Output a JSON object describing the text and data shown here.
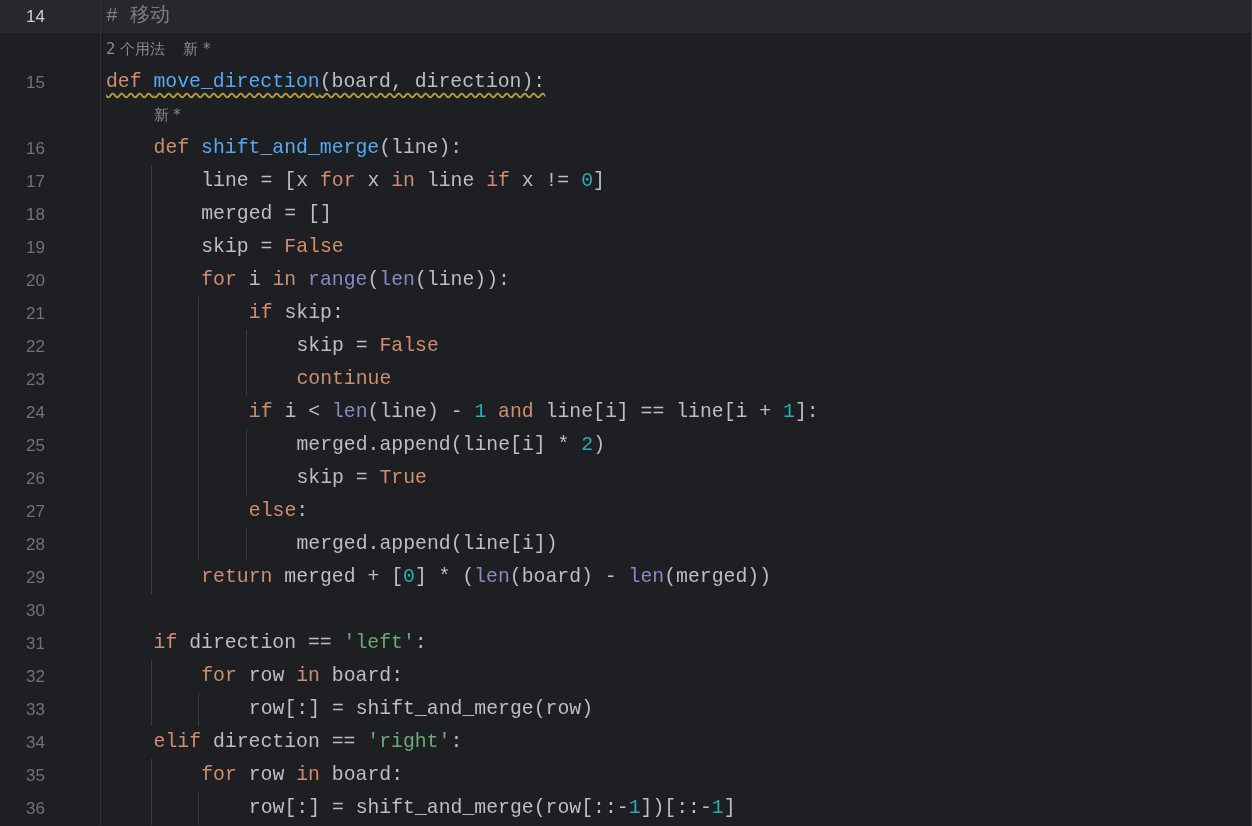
{
  "editor": {
    "lines": [
      {
        "number": "14",
        "current": true,
        "warning": false,
        "tokens": [
          {
            "text": "# 移动",
            "kind": "comment"
          }
        ]
      },
      {
        "number": "15",
        "current": false,
        "warning": true,
        "hints": [
          "2 个用法",
          "新 *"
        ],
        "tokens": [
          {
            "text": "def ",
            "kind": "kw"
          },
          {
            "text": "move_direction",
            "kind": "fn"
          },
          {
            "text": "(board, direction):",
            "kind": "plain"
          }
        ],
        "children": [
          {
            "number": "16",
            "current": false,
            "warning": false,
            "hints": [
              "新 *"
            ],
            "tokens": [
              {
                "text": "def ",
                "kind": "kw"
              },
              {
                "text": "shift_and_merge",
                "kind": "fn"
              },
              {
                "text": "(line):",
                "kind": "plain"
              }
            ],
            "children": [
              {
                "number": "17",
                "current": false,
                "warning": false,
                "tokens": [
                  {
                    "text": "line = [x ",
                    "kind": "plain"
                  },
                  {
                    "text": "for",
                    "kind": "kw"
                  },
                  {
                    "text": " x ",
                    "kind": "plain"
                  },
                  {
                    "text": "in",
                    "kind": "kw"
                  },
                  {
                    "text": " line ",
                    "kind": "plain"
                  },
                  {
                    "text": "if",
                    "kind": "kw"
                  },
                  {
                    "text": " x != ",
                    "kind": "plain"
                  },
                  {
                    "text": "0",
                    "kind": "num"
                  },
                  {
                    "text": "]",
                    "kind": "plain"
                  }
                ]
              },
              {
                "number": "18",
                "current": false,
                "warning": false,
                "tokens": [
                  {
                    "text": "merged = []",
                    "kind": "plain"
                  }
                ]
              },
              {
                "number": "19",
                "current": false,
                "warning": false,
                "tokens": [
                  {
                    "text": "skip = ",
                    "kind": "plain"
                  },
                  {
                    "text": "False",
                    "kind": "kw"
                  }
                ]
              },
              {
                "number": "20",
                "current": false,
                "warning": false,
                "tokens": [
                  {
                    "text": "for",
                    "kind": "kw"
                  },
                  {
                    "text": " i ",
                    "kind": "plain"
                  },
                  {
                    "text": "in",
                    "kind": "kw"
                  },
                  {
                    "text": " range",
                    "kind": "builtin"
                  },
                  {
                    "text": "(",
                    "kind": "plain"
                  },
                  {
                    "text": "len",
                    "kind": "builtin"
                  },
                  {
                    "text": "(line)):",
                    "kind": "plain"
                  }
                ],
                "children": [
                  {
                    "number": "21",
                    "current": false,
                    "warning": false,
                    "tokens": [
                      {
                        "text": "if",
                        "kind": "kw"
                      },
                      {
                        "text": " skip:",
                        "kind": "plain"
                      }
                    ],
                    "children": [
                      {
                        "number": "22",
                        "current": false,
                        "warning": false,
                        "tokens": [
                          {
                            "text": "skip = ",
                            "kind": "plain"
                          },
                          {
                            "text": "False",
                            "kind": "kw"
                          }
                        ]
                      },
                      {
                        "number": "23",
                        "current": false,
                        "warning": false,
                        "tokens": [
                          {
                            "text": "continue",
                            "kind": "kw"
                          }
                        ]
                      }
                    ]
                  },
                  {
                    "number": "24",
                    "current": false,
                    "warning": false,
                    "tokens": [
                      {
                        "text": "if",
                        "kind": "kw"
                      },
                      {
                        "text": " i < ",
                        "kind": "plain"
                      },
                      {
                        "text": "len",
                        "kind": "builtin"
                      },
                      {
                        "text": "(line) - ",
                        "kind": "plain"
                      },
                      {
                        "text": "1",
                        "kind": "num"
                      },
                      {
                        "text": " and",
                        "kind": "kw"
                      },
                      {
                        "text": " line[i] == line[i + ",
                        "kind": "plain"
                      },
                      {
                        "text": "1",
                        "kind": "num"
                      },
                      {
                        "text": "]:",
                        "kind": "plain"
                      }
                    ],
                    "children": [
                      {
                        "number": "25",
                        "current": false,
                        "warning": false,
                        "tokens": [
                          {
                            "text": "merged.append(line[i] * ",
                            "kind": "plain"
                          },
                          {
                            "text": "2",
                            "kind": "num"
                          },
                          {
                            "text": ")",
                            "kind": "plain"
                          }
                        ]
                      },
                      {
                        "number": "26",
                        "current": false,
                        "warning": false,
                        "tokens": [
                          {
                            "text": "skip = ",
                            "kind": "plain"
                          },
                          {
                            "text": "True",
                            "kind": "kw"
                          }
                        ]
                      }
                    ]
                  },
                  {
                    "number": "27",
                    "current": false,
                    "warning": false,
                    "tokens": [
                      {
                        "text": "else",
                        "kind": "kw"
                      },
                      {
                        "text": ":",
                        "kind": "plain"
                      }
                    ],
                    "children": [
                      {
                        "number": "28",
                        "current": false,
                        "warning": false,
                        "tokens": [
                          {
                            "text": "merged.append(line[i])",
                            "kind": "plain"
                          }
                        ]
                      }
                    ]
                  }
                ]
              },
              {
                "number": "29",
                "current": false,
                "warning": false,
                "tokens": [
                  {
                    "text": "return",
                    "kind": "kw"
                  },
                  {
                    "text": " merged + [",
                    "kind": "plain"
                  },
                  {
                    "text": "0",
                    "kind": "num"
                  },
                  {
                    "text": "] * (",
                    "kind": "plain"
                  },
                  {
                    "text": "len",
                    "kind": "builtin"
                  },
                  {
                    "text": "(board) - ",
                    "kind": "plain"
                  },
                  {
                    "text": "len",
                    "kind": "builtin"
                  },
                  {
                    "text": "(merged))",
                    "kind": "plain"
                  }
                ]
              }
            ]
          },
          {
            "number": "30",
            "current": false
          },
          {
            "number": "31",
            "current": false,
            "warning": false,
            "tokens": [
              {
                "text": "if",
                "kind": "kw"
              },
              {
                "text": " direction == ",
                "kind": "plain"
              },
              {
                "text": "'left'",
                "kind": "str"
              },
              {
                "text": ":",
                "kind": "plain"
              }
            ],
            "children": [
              {
                "number": "32",
                "current": false,
                "warning": false,
                "tokens": [
                  {
                    "text": "for",
                    "kind": "kw"
                  },
                  {
                    "text": " row ",
                    "kind": "plain"
                  },
                  {
                    "text": "in",
                    "kind": "kw"
                  },
                  {
                    "text": " board:",
                    "kind": "plain"
                  }
                ],
                "children": [
                  {
                    "number": "33",
                    "current": false,
                    "warning": false,
                    "tokens": [
                      {
                        "text": "row[:] = shift_and_merge(row)",
                        "kind": "plain"
                      }
                    ]
                  }
                ]
              }
            ]
          },
          {
            "number": "34",
            "current": false,
            "warning": false,
            "tokens": [
              {
                "text": "elif",
                "kind": "kw"
              },
              {
                "text": " direction == ",
                "kind": "plain"
              },
              {
                "text": "'right'",
                "kind": "str"
              },
              {
                "text": ":",
                "kind": "plain"
              }
            ],
            "children": [
              {
                "number": "35",
                "current": false,
                "warning": false,
                "tokens": [
                  {
                    "text": "for",
                    "kind": "kw"
                  },
                  {
                    "text": " row ",
                    "kind": "plain"
                  },
                  {
                    "text": "in",
                    "kind": "kw"
                  },
                  {
                    "text": " board:",
                    "kind": "plain"
                  }
                ],
                "children": [
                  {
                    "number": "36",
                    "current": false,
                    "warning": false,
                    "tokens": [
                      {
                        "text": "row[:] = shift_and_merge(row[::-",
                        "kind": "plain"
                      },
                      {
                        "text": "1",
                        "kind": "num"
                      },
                      {
                        "text": "])[::-",
                        "kind": "plain"
                      },
                      {
                        "text": "1",
                        "kind": "num"
                      },
                      {
                        "text": "]",
                        "kind": "plain"
                      }
                    ]
                  }
                ]
              }
            ]
          }
        ]
      }
    ]
  }
}
